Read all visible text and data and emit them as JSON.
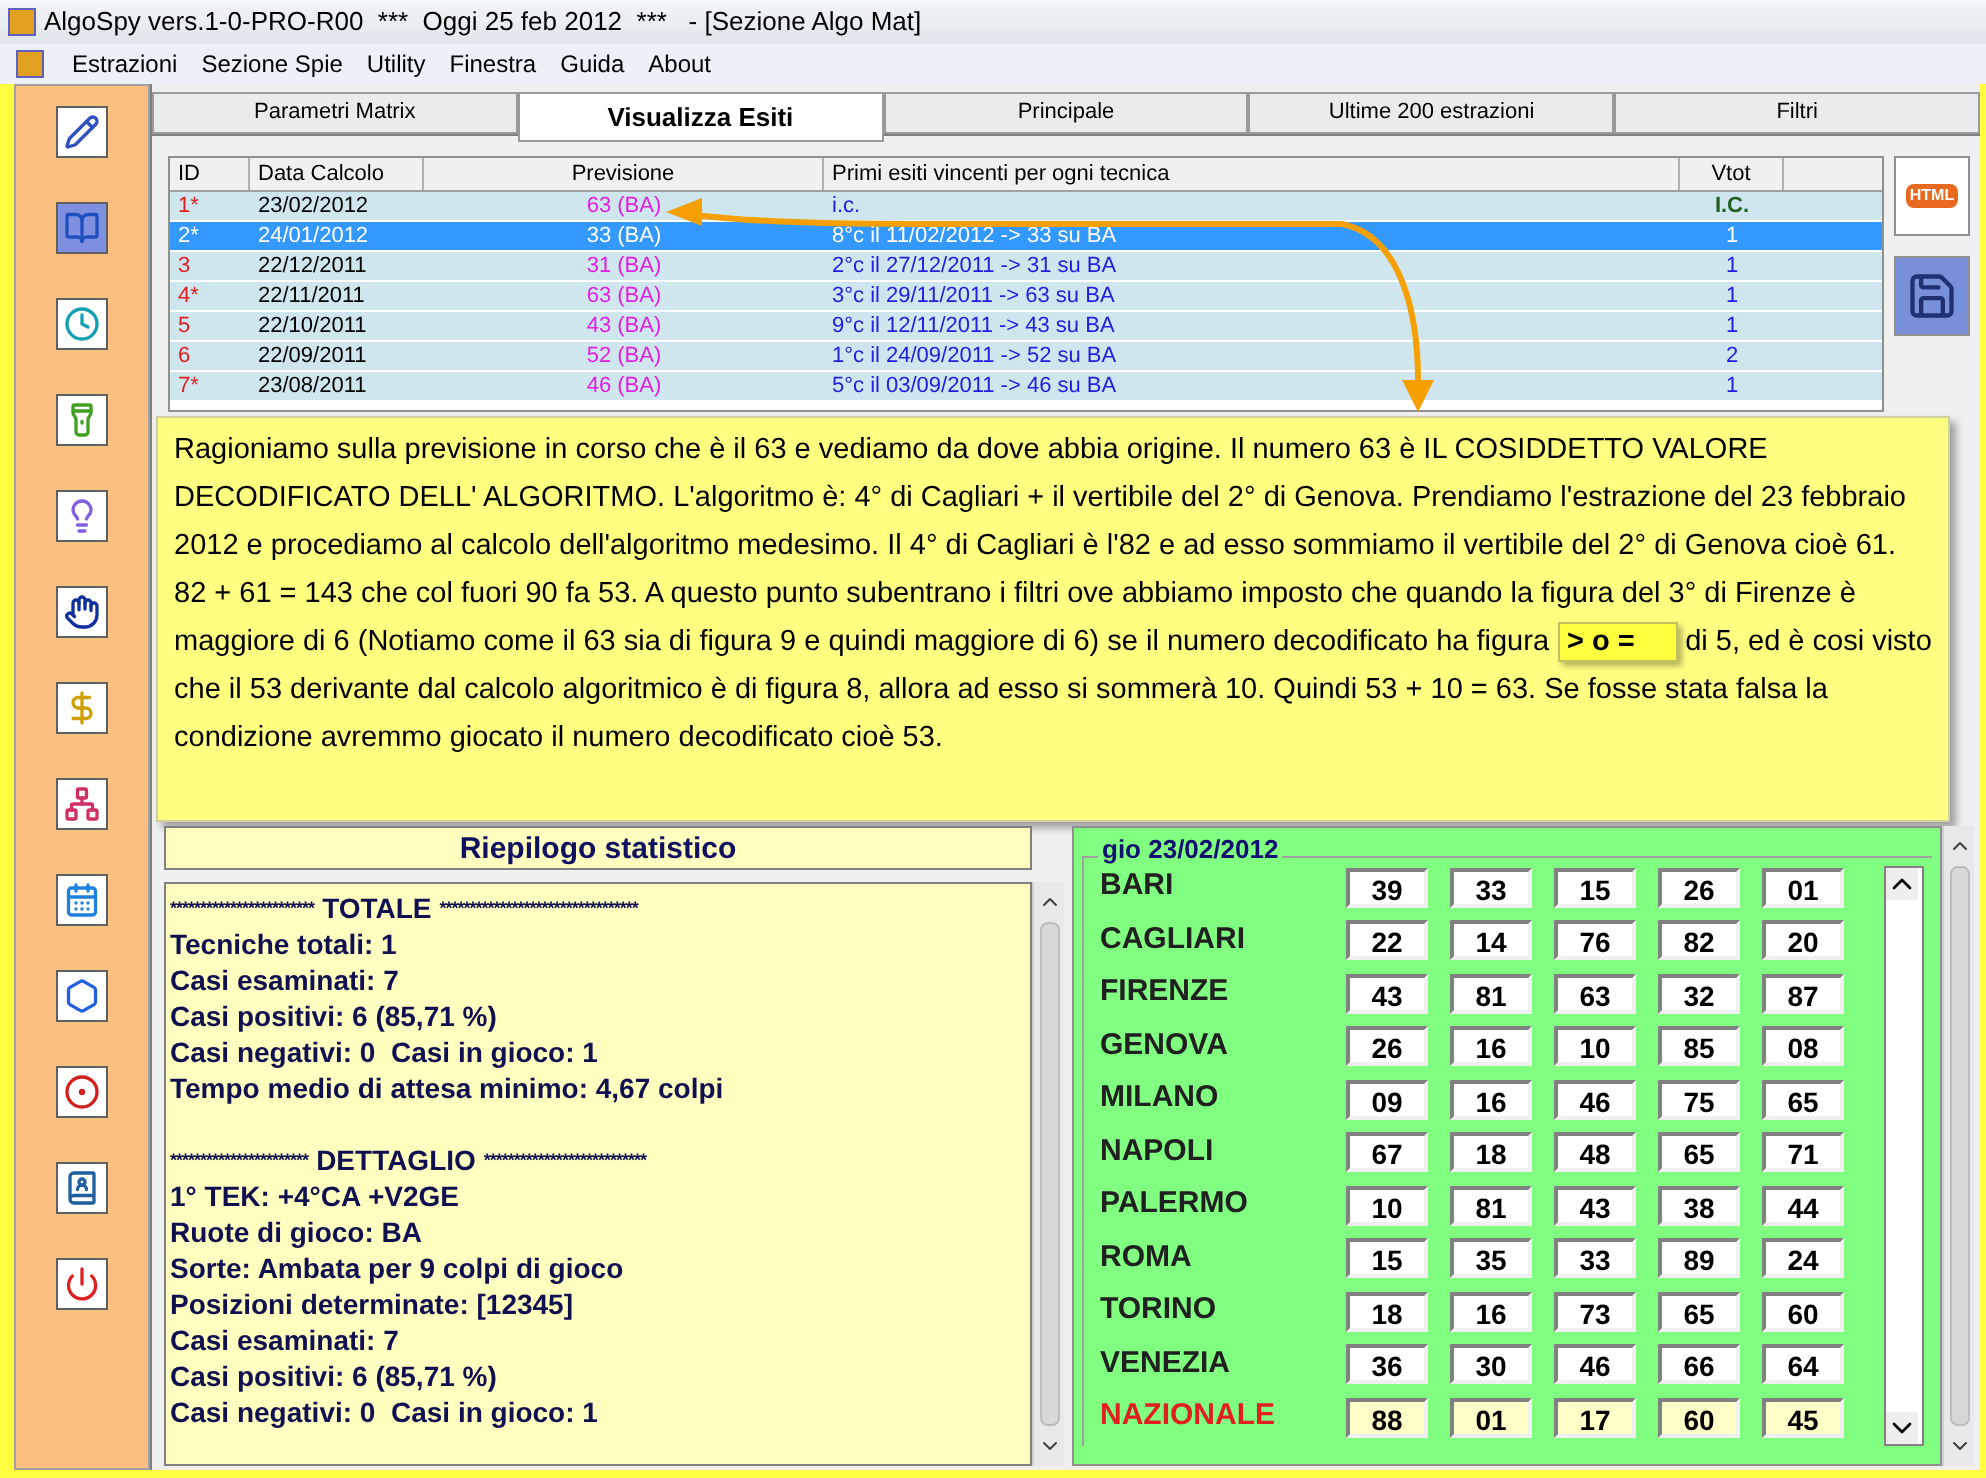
{
  "window": {
    "title": "AlgoSpy vers.1-0-PRO-R00  ***  Oggi 25 feb 2012  ***   - [Sezione Algo Mat]"
  },
  "menu": [
    "Estrazioni",
    "Sezione Spie",
    "Utility",
    "Finestra",
    "Guida",
    "About"
  ],
  "toolbar": [
    {
      "selected": false
    },
    {
      "selected": true
    },
    {
      "selected": false
    },
    {
      "selected": false
    },
    {
      "selected": false
    },
    {
      "selected": false
    },
    {
      "selected": false
    },
    {
      "selected": false
    },
    {
      "selected": false
    },
    {
      "selected": false
    },
    {
      "selected": false
    },
    {
      "selected": false
    },
    {
      "selected": false
    }
  ],
  "tabs": [
    {
      "label": "Parametri Matrix",
      "selected": false
    },
    {
      "label": "Visualizza Esiti",
      "selected": true
    },
    {
      "label": "Principale",
      "selected": false
    },
    {
      "label": "Ultime 200 estrazioni",
      "selected": false
    },
    {
      "label": "Filtri",
      "selected": false
    }
  ],
  "table": {
    "columns": [
      "ID",
      "Data Calcolo",
      "Previsione",
      "Primi esiti vincenti per ogni tecnica",
      "Vtot"
    ],
    "rows": [
      {
        "id": "1*",
        "date": "23/02/2012",
        "forecast": "63 (BA)",
        "outcome": "i.c.",
        "vtot": "I.C.",
        "selected": false
      },
      {
        "id": "2*",
        "date": "24/01/2012",
        "forecast": "33 (BA)",
        "outcome": "8°c il 11/02/2012 -> 33 su BA",
        "vtot": "1",
        "selected": true
      },
      {
        "id": "3",
        "date": "22/12/2011",
        "forecast": "31 (BA)",
        "outcome": "2°c il 27/12/2011 -> 31 su BA",
        "vtot": "1",
        "selected": false
      },
      {
        "id": "4*",
        "date": "22/11/2011",
        "forecast": "63 (BA)",
        "outcome": "3°c il 29/11/2011 -> 63 su BA",
        "vtot": "1",
        "selected": false
      },
      {
        "id": "5",
        "date": "22/10/2011",
        "forecast": "43 (BA)",
        "outcome": "9°c il 12/11/2011 -> 43 su BA",
        "vtot": "1",
        "selected": false
      },
      {
        "id": "6",
        "date": "22/09/2011",
        "forecast": "52 (BA)",
        "outcome": "1°c il 24/09/2011 -> 52 su BA",
        "vtot": "2",
        "selected": false
      },
      {
        "id": "7*",
        "date": "23/08/2011",
        "forecast": "46 (BA)",
        "outcome": "5°c il 03/09/2011 -> 46 su BA",
        "vtot": "1",
        "selected": false
      }
    ]
  },
  "side_buttons": {
    "html_label": "HTML"
  },
  "callout": {
    "before": "Ragioniamo sulla previsione in corso che è il 63 e vediamo da dove abbia origine. Il numero 63 è IL COSIDDETTO VALORE DECODIFICATO DELL' ALGORITMO. L'algoritmo è: 4° di Cagliari + il vertibile del 2° di Genova. Prendiamo l'estrazione del 23 febbraio 2012 e procediamo al calcolo dell'algoritmo medesimo. Il 4° di Cagliari è l'82 e ad esso sommiamo il vertibile del 2° di Genova cioè 61. 82 + 61 = 143 che col fuori 90 fa 53. A questo punto subentrano i filtri ove abbiamo imposto che quando la figura del 3° di Firenze è maggiore di 6 (Notiamo come il 63 sia di figura 9 e quindi maggiore di 6) se il numero decodificato ha figura",
    "highlight": "> o =",
    "after": "di 5, ed è cosi visto che il 53 derivante dal calcolo algoritmico è di figura 8, allora ad esso si sommerà 10. Quindi 53 + 10 = 63. Se fosse stata falsa la condizione avremmo giocato il numero decodificato cioè 53."
  },
  "stats": {
    "title": "Riepilogo statistico",
    "lines": [
      {
        "kind": "header",
        "left": "************************",
        "title": "TOTALE",
        "right": "*********************************"
      },
      {
        "kind": "line",
        "text": "Tecniche totali: 1"
      },
      {
        "kind": "line",
        "text": "Casi esaminati: 7"
      },
      {
        "kind": "line",
        "text": "Casi positivi: 6 (85,71 %)"
      },
      {
        "kind": "line",
        "text": "Casi negativi: 0  Casi in gioco: 1"
      },
      {
        "kind": "line",
        "text": "Tempo medio di attesa minimo: 4,67 colpi"
      },
      {
        "kind": "header",
        "left": "***********************",
        "title": "DETTAGLIO",
        "right": "***************************"
      },
      {
        "kind": "line",
        "text": "1° TEK: +4°CA +V2GE"
      },
      {
        "kind": "line",
        "text": "Ruote di gioco: BA"
      },
      {
        "kind": "line",
        "text": "Sorte: Ambata per 9 colpi di gioco"
      },
      {
        "kind": "line",
        "text": "Posizioni determinate: [12345]"
      },
      {
        "kind": "line",
        "text": "Casi esaminati: 7"
      },
      {
        "kind": "line",
        "text": "Casi positivi: 6 (85,71 %)"
      },
      {
        "kind": "line",
        "text": "Casi negativi: 0  Casi in gioco: 1"
      }
    ]
  },
  "draw": {
    "date": "gio 23/02/2012",
    "wheels": [
      {
        "kind": "regular",
        "name": "BARI",
        "numbers": [
          "39",
          "33",
          "15",
          "26",
          "01"
        ]
      },
      {
        "kind": "regular",
        "name": "CAGLIARI",
        "numbers": [
          "22",
          "14",
          "76",
          "82",
          "20"
        ]
      },
      {
        "kind": "regular",
        "name": "FIRENZE",
        "numbers": [
          "43",
          "81",
          "63",
          "32",
          "87"
        ]
      },
      {
        "kind": "regular",
        "name": "GENOVA",
        "numbers": [
          "26",
          "16",
          "10",
          "85",
          "08"
        ]
      },
      {
        "kind": "regular",
        "name": "MILANO",
        "numbers": [
          "09",
          "16",
          "46",
          "75",
          "65"
        ]
      },
      {
        "kind": "regular",
        "name": "NAPOLI",
        "numbers": [
          "67",
          "18",
          "48",
          "65",
          "71"
        ]
      },
      {
        "kind": "regular",
        "name": "PALERMO",
        "numbers": [
          "10",
          "81",
          "43",
          "38",
          "44"
        ]
      },
      {
        "kind": "regular",
        "name": "ROMA",
        "numbers": [
          "15",
          "35",
          "33",
          "89",
          "24"
        ]
      },
      {
        "kind": "regular",
        "name": "TORINO",
        "numbers": [
          "18",
          "16",
          "73",
          "65",
          "60"
        ]
      },
      {
        "kind": "regular",
        "name": "VENEZIA",
        "numbers": [
          "36",
          "30",
          "46",
          "66",
          "64"
        ]
      },
      {
        "kind": "national",
        "name": "NAZIONALE",
        "numbers": [
          "88",
          "01",
          "17",
          "60",
          "45"
        ]
      }
    ]
  }
}
